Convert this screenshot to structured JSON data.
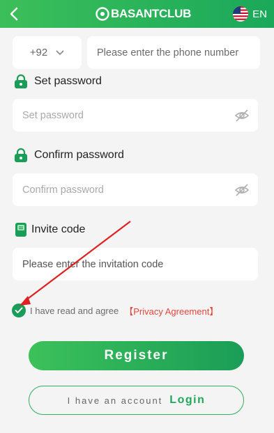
{
  "header": {
    "brand": "BASANTCLUB",
    "language": "EN",
    "icons": {
      "back": "chevron-left-icon",
      "flag": "us-flag-icon"
    },
    "color": "#2bb05f"
  },
  "phone": {
    "country_code": "+92",
    "placeholder": "Please enter the phone number"
  },
  "set_password": {
    "label": "Set password",
    "placeholder": "Set password",
    "icon": "lock-icon"
  },
  "confirm_password": {
    "label": "Confirm password",
    "placeholder": "Confirm password",
    "icon": "lock-icon"
  },
  "invite": {
    "label": "Invite code",
    "placeholder": "Please enter the invitation code",
    "icon": "invite-card-icon"
  },
  "agreement": {
    "text": "I have read and agree",
    "link": "【Privacy Agreement】",
    "checked": true
  },
  "register": {
    "label": "Register"
  },
  "login": {
    "prompt": "I have an account",
    "label": "Login"
  },
  "colors": {
    "accent": "#1a9d57",
    "link": "#e5453b",
    "annotation_arrow": "#e02020"
  }
}
